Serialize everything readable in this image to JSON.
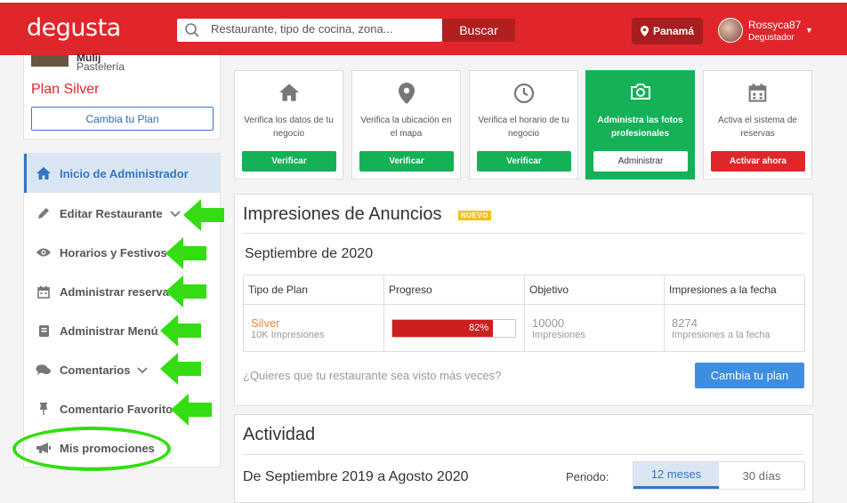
{
  "header": {
    "logo": "degusta",
    "search_placeholder": "Restaurante, tipo de cocina, zona...",
    "search_button": "Buscar",
    "location": "Panamá",
    "user_name": "Rossyca87",
    "user_role": "Degustador"
  },
  "profile": {
    "name_partial": "Mulij",
    "category": "Pastelería",
    "plan": "Plan Silver",
    "change_plan": "Cambia tu Plan"
  },
  "sidebar": {
    "items": [
      {
        "label": "Inicio de Administrador",
        "icon": "home-icon"
      },
      {
        "label": "Editar Restaurante",
        "icon": "pencil-icon"
      },
      {
        "label": "Horarios y Festivos",
        "icon": "eye-icon"
      },
      {
        "label": "Administrar reservas",
        "icon": "calendar-icon"
      },
      {
        "label": "Administrar Menú",
        "icon": "book-icon"
      },
      {
        "label": "Comentarios",
        "icon": "comments-icon"
      },
      {
        "label": "Comentario Favorito",
        "icon": "pin-icon"
      },
      {
        "label": "Mis promociones",
        "icon": "megaphone-icon"
      }
    ]
  },
  "tiles": [
    {
      "text": "Verifica los datos de tu negocio",
      "button": "Verificar",
      "icon": "home-icon"
    },
    {
      "text": "Verifica la ubicación en el mapa",
      "button": "Verificar",
      "icon": "map-marker-icon"
    },
    {
      "text": "Verifica el horario de tu negocio",
      "button": "Verificar",
      "icon": "clock-icon"
    },
    {
      "text": "Administra las fotos profesionales",
      "button": "Administrar",
      "icon": "camera-icon"
    },
    {
      "text": "Activa el sistema de reservas",
      "button": "Activar ahora",
      "icon": "calendar-icon"
    }
  ],
  "impressions": {
    "title": "Impresiones de Anuncios",
    "badge": "NUEVO",
    "month": "Septiembre de 2020",
    "columns": [
      "Tipo de Plan",
      "Progreso",
      "Objetivo",
      "Impresiones a la fecha"
    ],
    "row": {
      "plan": "Silver",
      "plan_sub": "10K Impresiones",
      "progress": 0.82,
      "progress_label": "82%",
      "goal": "10000",
      "goal_sub": "Impresiones",
      "current": "8274",
      "current_sub": "Impresiones a la fecha"
    },
    "cta_text": "¿Quieres que tu restaurante sea visto más veces?",
    "cta_button": "Cambia tu plan"
  },
  "activity": {
    "title": "Actividad",
    "range": "De Septiembre 2019 a Agosto 2020",
    "period_label": "Periodo:",
    "options": [
      "12 meses",
      "30 días"
    ]
  },
  "colors": {
    "brand": "#e0262b",
    "green": "#14b157",
    "blue": "#3574c4",
    "annotation": "#33dd11"
  }
}
